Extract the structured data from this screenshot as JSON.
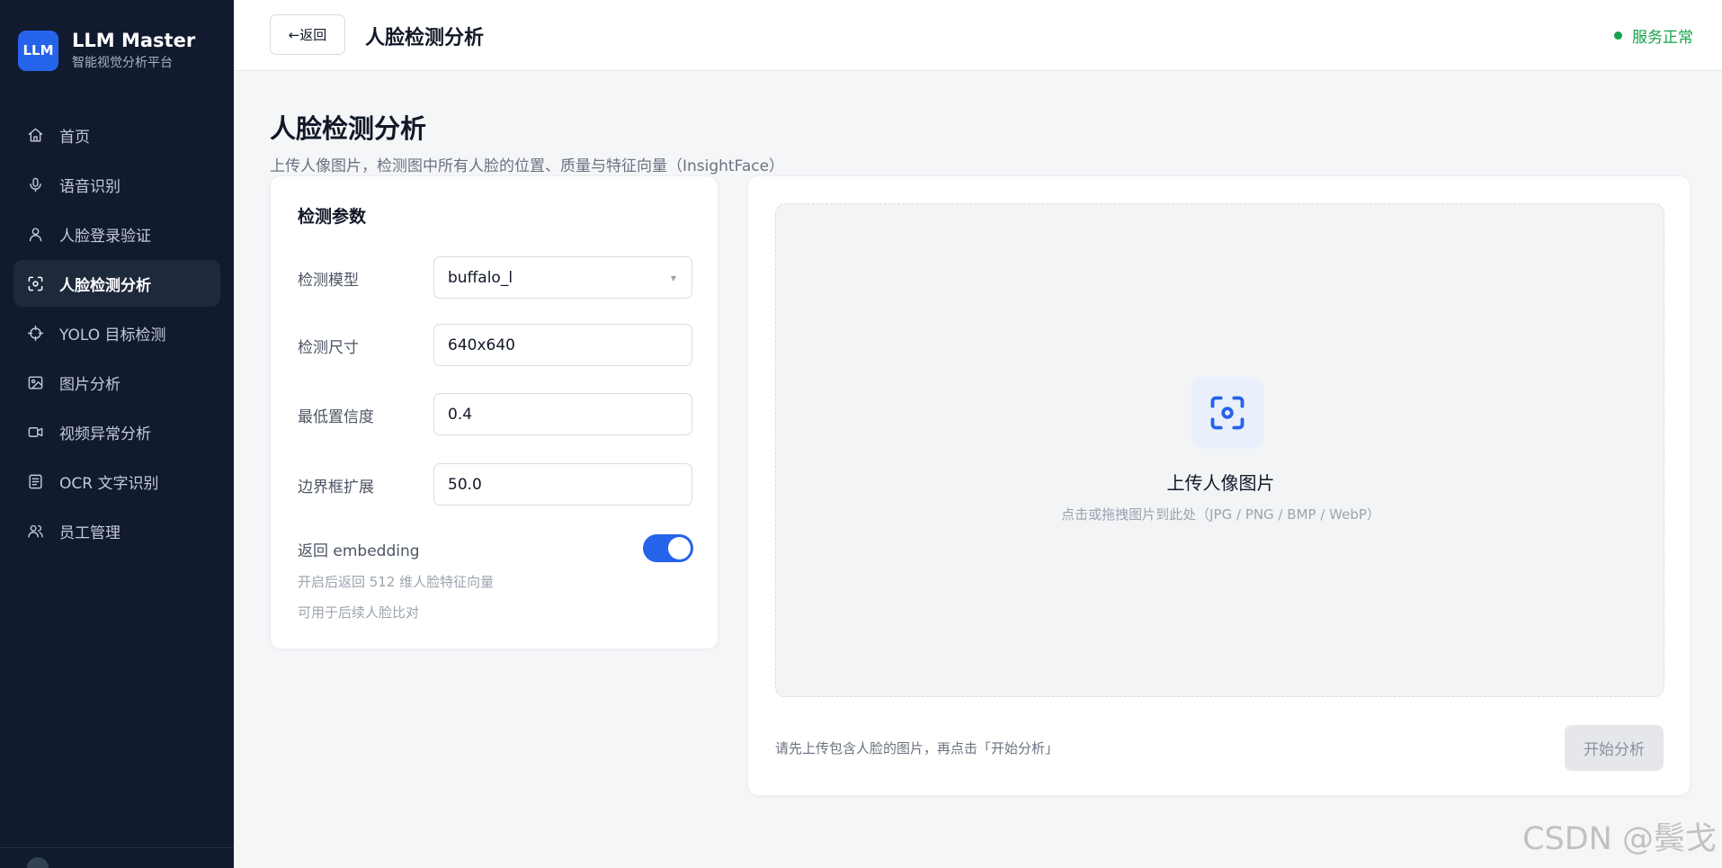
{
  "brand": {
    "logo": "LLM",
    "name": "LLM Master",
    "subtitle": "智能视觉分析平台"
  },
  "sidebar": {
    "items": [
      {
        "label": "首页",
        "icon": "home-icon"
      },
      {
        "label": "语音识别",
        "icon": "mic-icon"
      },
      {
        "label": "人脸登录验证",
        "icon": "user-icon"
      },
      {
        "label": "人脸检测分析",
        "icon": "face-scan-icon",
        "active": true
      },
      {
        "label": "YOLO 目标检测",
        "icon": "crosshair-icon"
      },
      {
        "label": "图片分析",
        "icon": "image-icon"
      },
      {
        "label": "视频异常分析",
        "icon": "video-icon"
      },
      {
        "label": "OCR 文字识别",
        "icon": "document-icon"
      },
      {
        "label": "员工管理",
        "icon": "users-icon"
      }
    ]
  },
  "header": {
    "back_arrow": "←",
    "back_label": "返回",
    "title": "人脸检测分析",
    "status_text": "服务正常",
    "status_color": "#16a34a"
  },
  "page": {
    "title": "人脸检测分析",
    "subtitle": "上传人像图片，检测图中所有人脸的位置、质量与特征向量（InsightFace）"
  },
  "params": {
    "title": "检测参数",
    "model_label": "检测模型",
    "model_value": "buffalo_l",
    "size_label": "检测尺寸",
    "size_value": "640x640",
    "confidence_label": "最低置信度",
    "confidence_value": "0.4",
    "expand_label": "边界框扩展",
    "expand_value": "50.0",
    "embedding_label": "返回 embedding",
    "embedding_enabled": true,
    "hint1": "开启后返回 512 维人脸特征向量",
    "hint2": "可用于后续人脸比对"
  },
  "upload": {
    "title": "上传人像图片",
    "hint": "点击或拖拽图片到此处（JPG / PNG / BMP / WebP）",
    "footer_hint": "请先上传包含人脸的图片，再点击「开始分析」",
    "start_label": "开始分析"
  },
  "watermark": "CSDN @鬓戈",
  "colors": {
    "accent": "#2563eb",
    "sidebar_bg": "#111a2e",
    "status": "#16a34a"
  }
}
